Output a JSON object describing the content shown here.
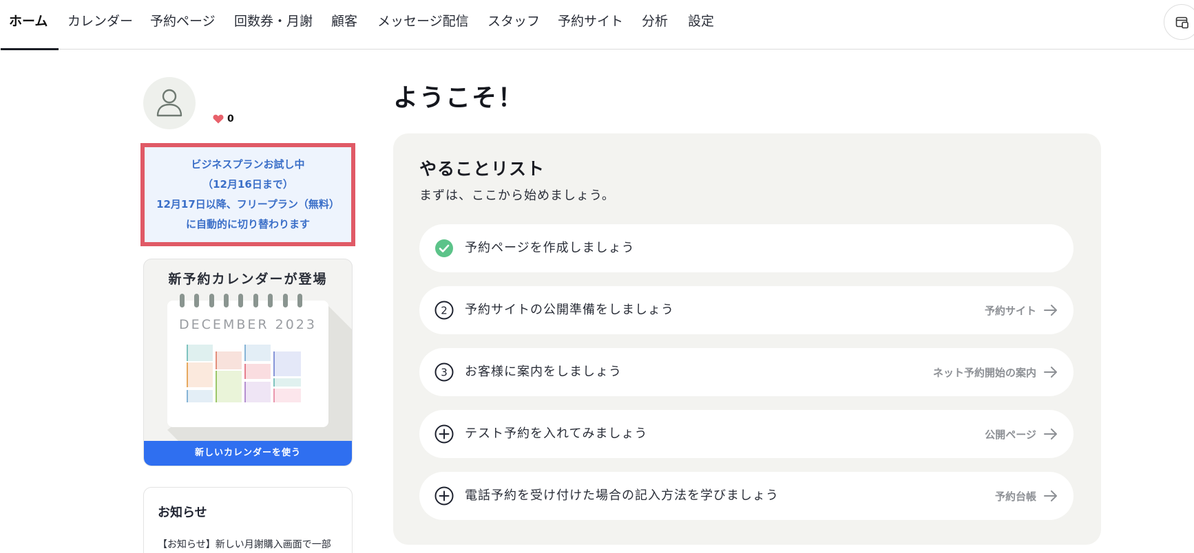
{
  "nav": {
    "tabs": [
      {
        "label": "ホーム",
        "active": true
      },
      {
        "label": "カレンダー"
      },
      {
        "label": "予約ページ"
      },
      {
        "label": "回数券・月謝"
      },
      {
        "label": "顧客"
      },
      {
        "label": "メッセージ配信"
      },
      {
        "label": "スタッフ"
      },
      {
        "label": "予約サイト"
      },
      {
        "label": "分析"
      },
      {
        "label": "設定"
      }
    ]
  },
  "profile": {
    "likes_count": "0"
  },
  "trial": {
    "line1": "ビジネスプランお試し中",
    "line2": "（12月16日まで）",
    "line3": "12月17日以降、フリープラン（無料）",
    "line4": "に自動的に切り替わります"
  },
  "promo": {
    "title": "新予約カレンダーが登場",
    "month": "DECEMBER 2023",
    "button_label": "新しいカレンダーを使う"
  },
  "news": {
    "title": "お知らせ",
    "item": "【お知らせ】新しい月謝購入画面で一部"
  },
  "main": {
    "welcome": "ようこそ！",
    "todo_title": "やることリスト",
    "todo_subtitle": "まずは、ここから始めましょう。",
    "items": [
      {
        "marker": "check",
        "label": "予約ページを作成しましょう",
        "link": ""
      },
      {
        "marker": "2",
        "label": "予約サイトの公開準備をしましょう",
        "link": "予約サイト"
      },
      {
        "marker": "3",
        "label": "お客様に案内をしましょう",
        "link": "ネット予約開始の案内"
      },
      {
        "marker": "plus",
        "label": "テスト予約を入れてみましょう",
        "link": "公開ページ"
      },
      {
        "marker": "plus",
        "label": "電話予約を受け付けた場合の記入方法を学びましょう",
        "link": "予約台帳"
      }
    ]
  },
  "colors": {
    "accent_blue": "#2f6ff0",
    "trial_border": "#e05a66",
    "trial_text": "#3b6fc8",
    "done_green": "#5cc389",
    "heart": "#e8616b"
  }
}
